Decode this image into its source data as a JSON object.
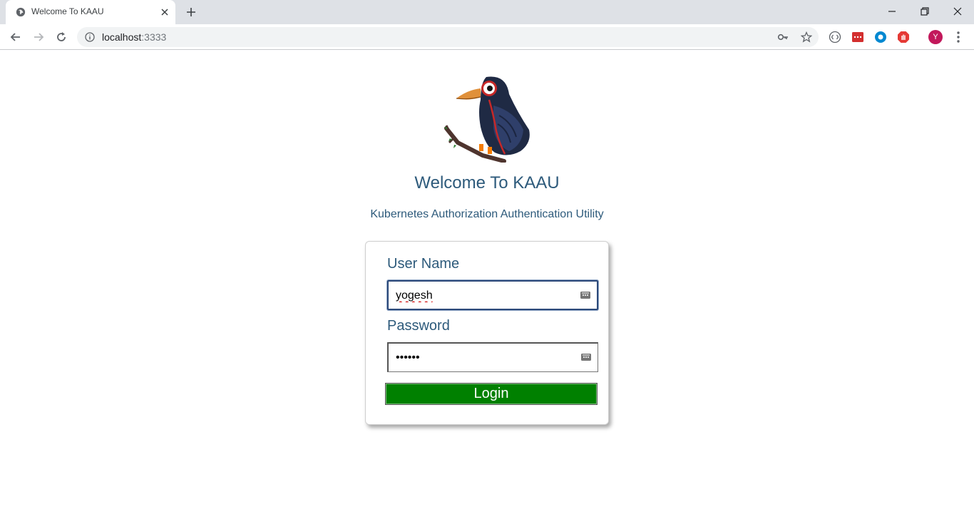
{
  "browser": {
    "tab_title": "Welcome To KAAU",
    "url_host": "localhost",
    "url_port": ":3333",
    "avatar_initial": "Y"
  },
  "page": {
    "welcome": "Welcome To KAAU",
    "subtitle": "Kubernetes Authorization Authentication Utility"
  },
  "login_form": {
    "username_label": "User Name",
    "username_value": "yogesh",
    "password_label": "Password",
    "password_value": "••••••",
    "login_label": "Login"
  },
  "colors": {
    "heading": "#2d5a7b",
    "login_button": "#008000",
    "avatar": "#c2185b"
  }
}
